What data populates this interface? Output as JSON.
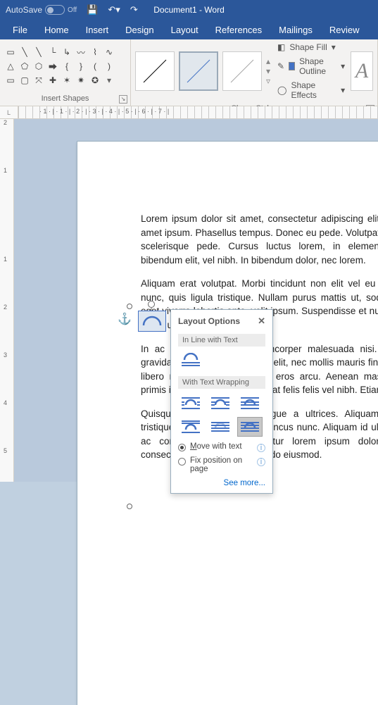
{
  "titlebar": {
    "autosave_label": "AutoSave",
    "autosave_state": "Off",
    "doc_title": "Document1  -  Word"
  },
  "tabs": [
    "File",
    "Home",
    "Insert",
    "Design",
    "Layout",
    "References",
    "Mailings",
    "Review"
  ],
  "ribbon": {
    "group_shapes_label": "Insert Shapes",
    "group_styles_label": "Shape Styles",
    "shape_fill": "Shape Fill",
    "shape_outline": "Shape Outline",
    "shape_effects": "Shape Effects",
    "textbox_glyph": "A"
  },
  "ruler": {
    "corner": "L",
    "h_numbers": "· 1 · | · 1 · | · 2 · | · 3 · | · 4 · | · 5 · | · 6 · | · 7 · |",
    "v_numbers": [
      "2",
      "1",
      "",
      "1",
      "2",
      "3",
      "4",
      "5"
    ]
  },
  "layout_options": {
    "title": "Layout Options",
    "section_inline": "In Line with Text",
    "section_wrap": "With Text Wrapping",
    "radio_move": "Move with text",
    "radio_fix": "Fix position on page",
    "see_more": "See more..."
  },
  "document": {
    "paragraphs": [
      "Lorem ipsum dolor sit amet, consectetur adipiscing elit. Integer sit amet ipsum. Phasellus tempus. Donec eu pede. Volutpat quam, quis scelerisque pede. Cursus luctus lorem, in elementum neque bibendum elit, vel nibh. In bibendum dolor, nec lorem.",
      "Aliquam erat volutpat. Morbi tincidunt non elit vel eu consectetur nunc, quis ligula tristique. Nullam purus mattis ut, sodales turpis, eget viverra lobortis ante, velit ipsum. Suspendisse et nunc ac, amet quam ullamcorper elit.",
      "In ac risus pulvinar, at ullamcorper malesuada nisi. Vestibulum gravida sapien interdum lectus elit, nec mollis mauris finibus justo at libero mollis sodales egestas eros arcu. Aenean massa. Nullam primis in faucibus. Integer feugiat felis felis vel nibh. Etiam.",
      "Quisque eleifend facilisis augue a ultrices. Aliquam sollicitudin tristique iaculis. Vestibulum rhoncus nunc. Aliquam id ultrices ligula, ac consectetur felis. Curabitur lorem ipsum dolor sit amet, consectetur adipiscing elit sed do eiusmod."
    ]
  }
}
